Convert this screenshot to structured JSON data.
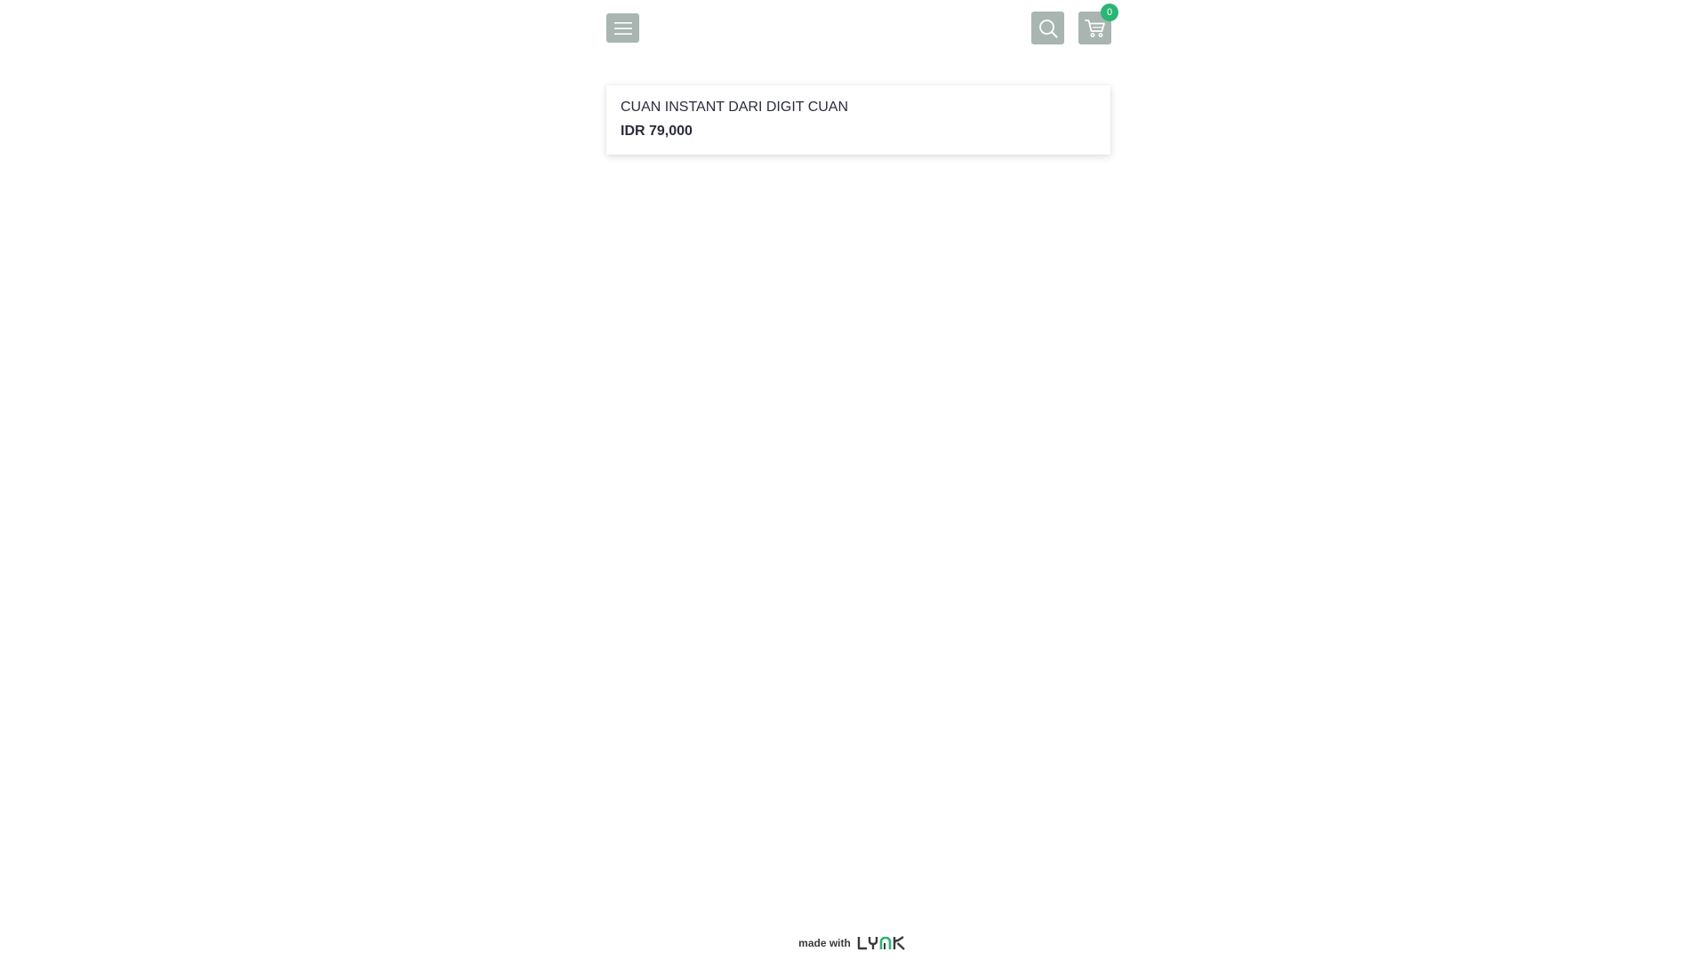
{
  "colors": {
    "icon_button_bg": "#a8b5b0",
    "icon_fg": "#ffffff",
    "badge_bg": "#2bb574",
    "text": "#2b2d3c",
    "logo_dark": "#3a3a3a",
    "logo_accent": "#2bb574"
  },
  "header": {
    "menu_icon": "hamburger-menu-icon",
    "search_icon": "search-icon",
    "cart_icon": "shopping-cart-icon",
    "cart_count": "0"
  },
  "product": {
    "title": "CUAN INSTANT DARI DIGIT CUAN",
    "price": "IDR 79,000"
  },
  "footer": {
    "made_with": "made with",
    "logo_text": "LYNK"
  }
}
